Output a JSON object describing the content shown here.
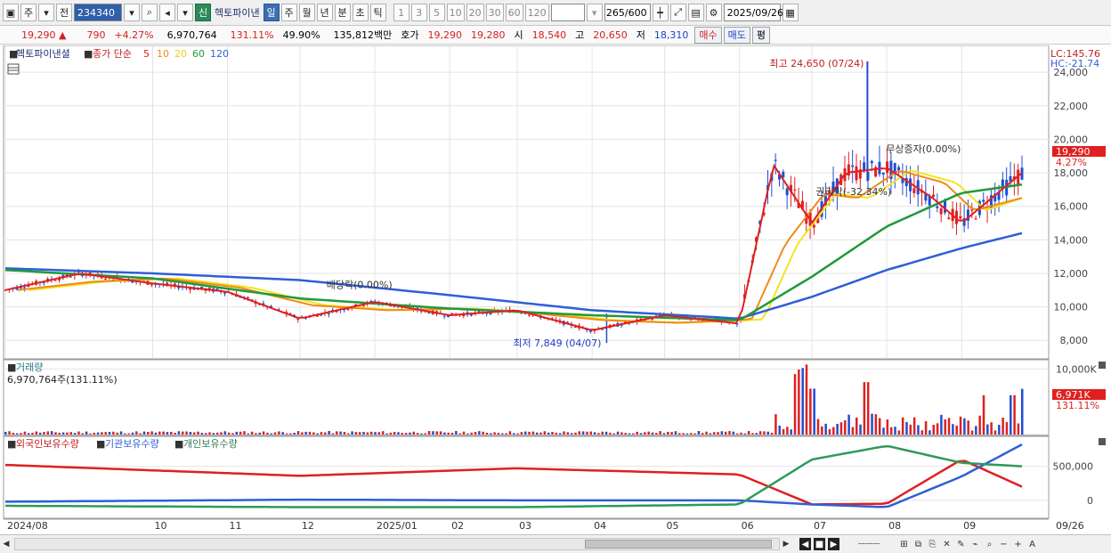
{
  "toolbar": {
    "market_label": "주",
    "prev_label": "전",
    "stock_code": "234340",
    "stock_tag": "신",
    "stock_name": "헥토파이낸",
    "periods": [
      "일",
      "주",
      "월",
      "년",
      "분",
      "초",
      "틱"
    ],
    "intervals": [
      "1",
      "3",
      "5",
      "10",
      "20",
      "30",
      "60",
      "120"
    ],
    "bar_count": "265",
    "bar_total": "/600",
    "date": "2025/09/26"
  },
  "quote": {
    "price": "19,290",
    "change": "790",
    "change_pct": "+4.27%",
    "volume": "6,970,764",
    "volume_ratio": "131.11%",
    "turnover": "49.90%",
    "amount": "135,812백만",
    "ask_label": "호가",
    "ask": "19,290",
    "bid": "19,280",
    "open_label": "시",
    "open": "18,540",
    "high_label": "고",
    "high": "20,650",
    "low_label": "저",
    "low": "18,310",
    "buy_label": "매수",
    "sell_label": "매도",
    "avg_label": "평"
  },
  "legend": {
    "name": "헥토파이낸셜",
    "close_label": "종가 단순",
    "ma_labels": [
      "5",
      "10",
      "20",
      "60",
      "120"
    ],
    "volume_title": "거래량",
    "volume_value": "6,970,764주(131.11%)",
    "holders": [
      "외국인보유수량",
      "기관보유수량",
      "개인보유수량"
    ]
  },
  "colors": {
    "candle_up": "#e02020",
    "candle_down": "#1f4fd0",
    "ma5": "#e02020",
    "ma10": "#f08a1a",
    "ma20": "#f4e320",
    "ma60": "#1f9a3a",
    "ma120": "#2f5fd6",
    "foreign": "#e02020",
    "institution": "#2f5fd6",
    "retail": "#2f9a5a"
  },
  "chart_data": [
    {
      "type": "candlestick",
      "title": "헥토파이낸셜",
      "x_ticks": [
        "2024/08",
        "10",
        "11",
        "12",
        "2025/01",
        "02",
        "03",
        "04",
        "05",
        "06",
        "07",
        "08",
        "09",
        "09/26"
      ],
      "y_ticks": [
        8000,
        10000,
        12000,
        14000,
        16000,
        18000,
        20000,
        22000,
        24000
      ],
      "ylim": [
        6950,
        25550
      ],
      "last_price": "19,290",
      "last_change": "4.27%",
      "lc_label": "LC:145.76",
      "hc_label": "HC:-21.74",
      "annotations": [
        {
          "text": "최고 24,650 (07/24)",
          "date": "2025/07/24",
          "value": 24650
        },
        {
          "text": "최저 7,849 (04/07)",
          "date": "2025/04/07",
          "value": 7849
        },
        {
          "text": "배당락(0.00%)",
          "date": "2024/12/26",
          "value": 10800
        },
        {
          "text": "무상증자(0.00%)",
          "date": "2025/07/28",
          "value": 18900
        },
        {
          "text": "권리락(-32.34%)",
          "date": "2025/07/10",
          "value": 16900
        }
      ],
      "series": [
        {
          "name": "5",
          "x": [
            "2024/08",
            "2024/09",
            "2024/10",
            "2024/11",
            "2024/12",
            "2025/01",
            "2025/02",
            "2025/03",
            "2025/04",
            "2025/05",
            "2025/06",
            "2025/06/15",
            "2025/07",
            "2025/07/15",
            "2025/08",
            "2025/08/20",
            "2025/09",
            "2025/09/26"
          ],
          "values": [
            11000,
            12000,
            11400,
            10900,
            9300,
            10300,
            9500,
            9800,
            8600,
            9500,
            9000,
            18500,
            15000,
            18000,
            18300,
            16500,
            15000,
            18000
          ]
        },
        {
          "name": "60",
          "x": [
            "2024/08",
            "2024/10",
            "2024/12",
            "2025/02",
            "2025/04",
            "2025/06",
            "2025/07",
            "2025/08",
            "2025/09",
            "2025/09/26"
          ],
          "values": [
            12200,
            11700,
            10500,
            9900,
            9500,
            9200,
            11800,
            14800,
            16800,
            17300
          ]
        },
        {
          "name": "120",
          "x": [
            "2024/08",
            "2024/10",
            "2024/12",
            "2025/02",
            "2025/04",
            "2025/06",
            "2025/07",
            "2025/08",
            "2025/09",
            "2025/09/26"
          ],
          "values": [
            12300,
            12000,
            11600,
            10700,
            9800,
            9300,
            10600,
            12200,
            13500,
            14400
          ]
        }
      ]
    },
    {
      "type": "bar",
      "title": "거래량",
      "y_ticks": [
        "0",
        "10,000K"
      ],
      "last_value": "6,971K",
      "last_ratio": "131.11%"
    },
    {
      "type": "line",
      "title": "보유수량",
      "y_ticks": [
        "0",
        "500,000"
      ],
      "series": [
        {
          "name": "외국인보유수량",
          "x": [
            "2024/08",
            "2024/12",
            "2025/03",
            "2025/06",
            "2025/07",
            "2025/08",
            "2025/09",
            "2025/09/26"
          ],
          "values": [
            520000,
            360000,
            470000,
            380000,
            -60000,
            -50000,
            600000,
            200000
          ]
        },
        {
          "name": "기관보유수량",
          "x": [
            "2024/08",
            "2024/12",
            "2025/03",
            "2025/06",
            "2025/07",
            "2025/08",
            "2025/09",
            "2025/09/26"
          ],
          "values": [
            -20000,
            10000,
            0,
            0,
            -60000,
            -100000,
            350000,
            820000
          ]
        },
        {
          "name": "개인보유수량",
          "x": [
            "2024/08",
            "2024/12",
            "2025/03",
            "2025/06",
            "2025/07",
            "2025/08",
            "2025/09",
            "2025/09/26"
          ],
          "values": [
            -80000,
            -100000,
            -100000,
            -60000,
            600000,
            800000,
            550000,
            500000
          ]
        }
      ]
    }
  ]
}
